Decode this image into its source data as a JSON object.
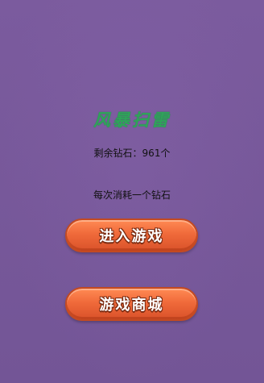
{
  "game": {
    "title": "风暴扫雷",
    "diamonds_text": "剩余钻石：961个",
    "cost_text": "每次消耗一个钻石"
  },
  "buttons": {
    "enter_label": "进入游戏",
    "shop_label": "游戏商城"
  },
  "colors": {
    "background": "#7a5a9c",
    "title": "#2fa35a",
    "button": "#f06a3a"
  }
}
